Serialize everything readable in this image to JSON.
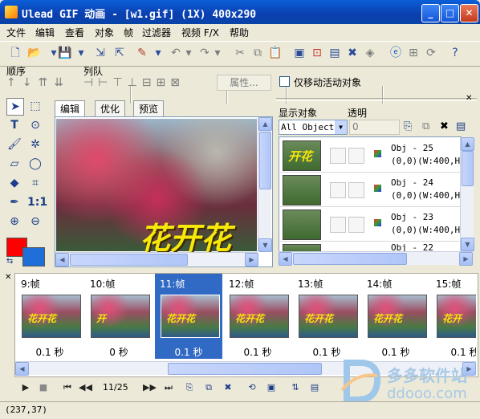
{
  "window": {
    "title": "Ulead GIF 动画 - [w1.gif] (1X) 400x290",
    "buttons": {
      "minimize": "_",
      "maximize": "□",
      "close": "✕"
    }
  },
  "menu": [
    "文件",
    "编辑",
    "查看",
    "对象",
    "帧",
    "过滤器",
    "视频 F/X",
    "帮助"
  ],
  "toolbar": {
    "icons": [
      "new-icon",
      "open-icon",
      "save-icon",
      "import-icon",
      "export-icon",
      "paint-icon",
      "undo-icon",
      "redo-icon",
      "cut-icon",
      "copy-icon",
      "paste-icon",
      "frame-icon",
      "optimize-icon",
      "delete-icon",
      "color-icon",
      "browser-icon",
      "mask-icon",
      "refresh-icon",
      "help-icon"
    ]
  },
  "order_bar": {
    "order_label": "顺序",
    "align_label": "列队",
    "properties_button": "属性...",
    "checkbox_label": "仅移动活动对象"
  },
  "canvas_tabs": [
    "编辑",
    "优化",
    "预览"
  ],
  "canvas": {
    "overlay_text": "花开花"
  },
  "objects_panel": {
    "show_label": "显示对象",
    "opacity_label": "透明",
    "filter_value": "All Object:",
    "opacity_value": "0",
    "objects": [
      {
        "name": "Obj - 25",
        "info": "(0,0)(W:400,H:",
        "thumb_text": "开花"
      },
      {
        "name": "Obj - 24",
        "info": "(0,0)(W:400,H:",
        "thumb_text": ""
      },
      {
        "name": "Obj - 23",
        "info": "(0,0)(W:400,H:",
        "thumb_text": ""
      },
      {
        "name": "Obj - 22",
        "info": "",
        "thumb_text": ""
      }
    ]
  },
  "frames": [
    {
      "label": "9:帧",
      "delay": "0.1 秒",
      "thumb_text": "花开花"
    },
    {
      "label": "10:帧",
      "delay": "0 秒",
      "thumb_text": "开"
    },
    {
      "label": "11:帧",
      "delay": "0.1 秒",
      "thumb_text": "花开花",
      "selected": true
    },
    {
      "label": "12:帧",
      "delay": "0.1 秒",
      "thumb_text": "花开花"
    },
    {
      "label": "13:帧",
      "delay": "0.1 秒",
      "thumb_text": "花开花"
    },
    {
      "label": "14:帧",
      "delay": "0.1 秒",
      "thumb_text": "花开花"
    },
    {
      "label": "15:帧",
      "delay": "0.1 秒",
      "thumb_text": "花开"
    }
  ],
  "playback": {
    "counter": "11/25"
  },
  "status": {
    "coords": "(237,37)"
  },
  "watermark": {
    "name": "多多软件站",
    "url": "ddooo.com"
  },
  "colors": {
    "foreground": "#ff0000",
    "background": "#1f6fd8",
    "selection": "#316ac5",
    "titlebar": "#0a4fc8"
  }
}
